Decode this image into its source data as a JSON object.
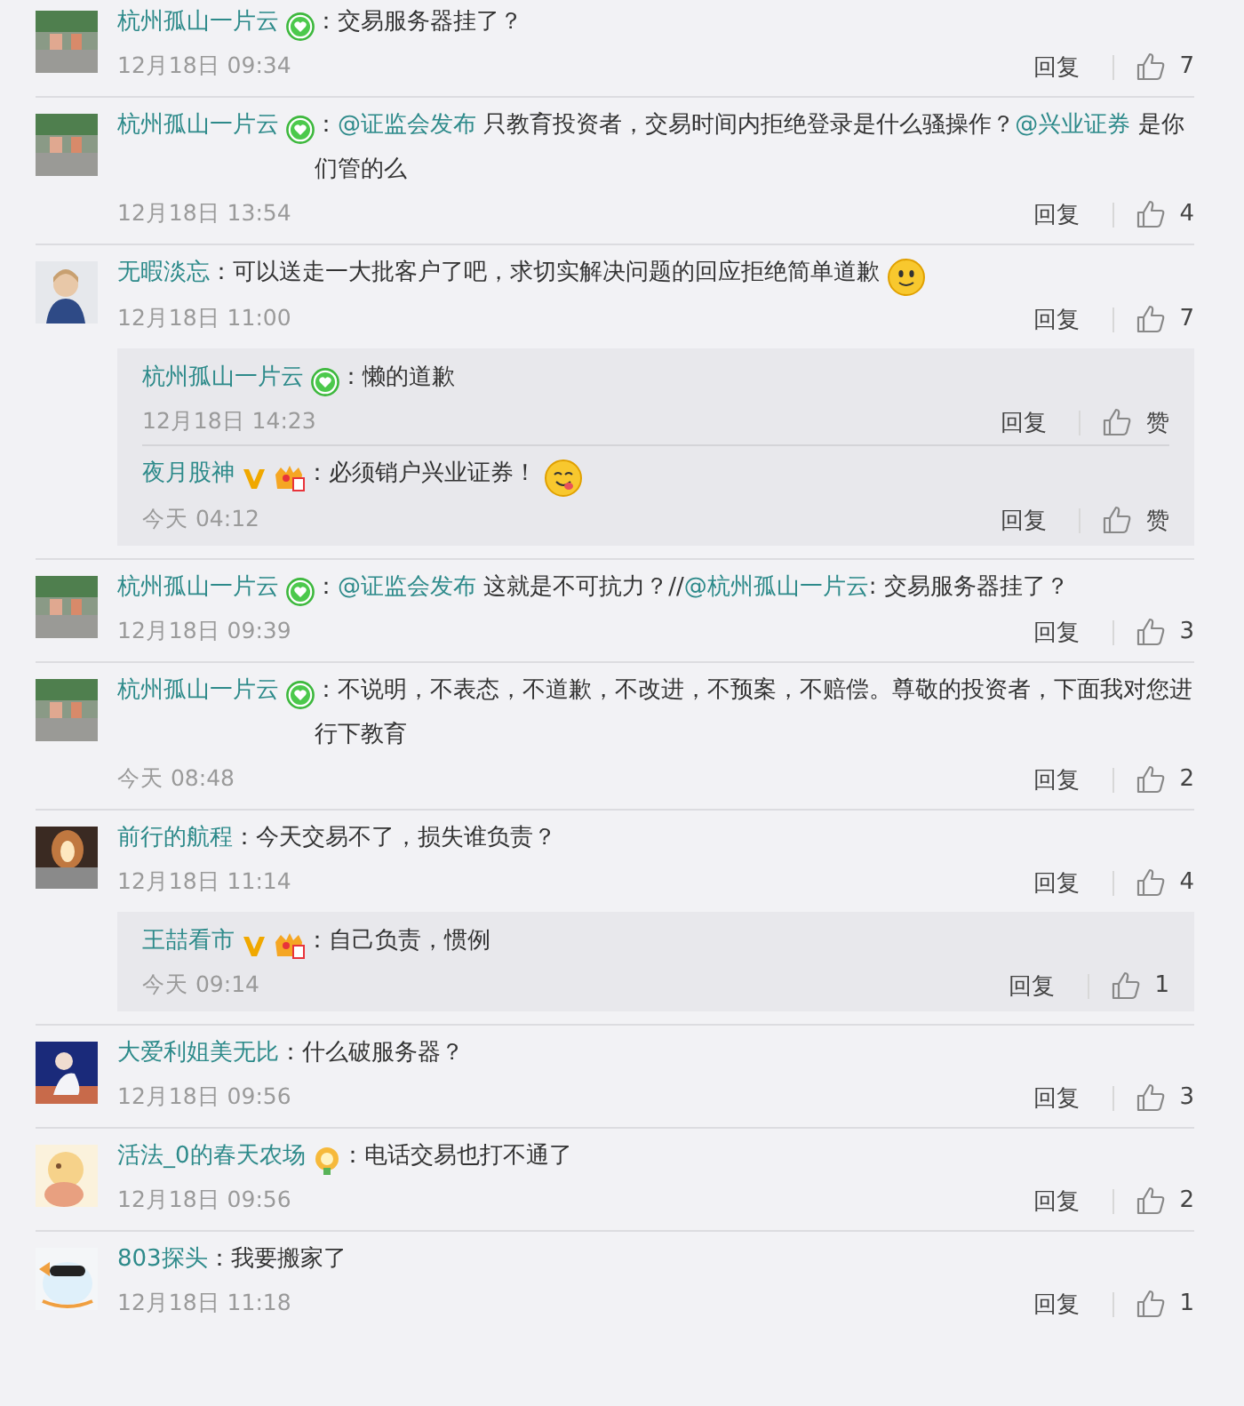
{
  "comments": [
    {
      "author": "杭州孤山一片云",
      "badges": [
        {
          "kind": "member"
        }
      ],
      "segments": [
        {
          "kind": "text",
          "text": "：交易服务器挂了？"
        }
      ],
      "time": "12月18日 09:34",
      "reply_label": "回复",
      "likes": "7"
    },
    {
      "author": "杭州孤山一片云",
      "badges": [
        {
          "kind": "member"
        }
      ],
      "segments": [
        {
          "kind": "text",
          "text": "："
        },
        {
          "kind": "mention",
          "text": "@证监会发布"
        },
        {
          "kind": "text",
          "text": " 只教育投资者，交易时间内拒绝登录是什么骚操作？"
        },
        {
          "kind": "mention",
          "text": "@兴业证券"
        },
        {
          "kind": "text",
          "text": " 是你们管的么"
        }
      ],
      "time": "12月18日 13:54",
      "reply_label": "回复",
      "likes": "4"
    },
    {
      "author": "无暇淡忘",
      "segments": [
        {
          "kind": "text",
          "text": "：可以送走一大批客户了吧，求切实解决问题的回应拒绝简单道歉"
        }
      ],
      "emoji": {
        "kind": "smile"
      },
      "time": "12月18日 11:00",
      "reply_label": "回复",
      "likes": "7",
      "replies": [
        {
          "author": "杭州孤山一片云",
          "badges": [
            {
              "kind": "member"
            }
          ],
          "segments": [
            {
              "kind": "text",
              "text": "：懒的道歉"
            }
          ],
          "time": "12月18日 14:23",
          "reply_label": "回复",
          "likes": "赞"
        },
        {
          "author": "夜月股神",
          "badges": [
            {
              "kind": "verified"
            },
            {
              "kind": "vip"
            }
          ],
          "segments": [
            {
              "kind": "text",
              "text": "：必须销户兴业证券！"
            }
          ],
          "emoji": {
            "kind": "yum"
          },
          "time": "今天 04:12",
          "reply_label": "回复",
          "likes": "赞"
        }
      ]
    },
    {
      "author": "杭州孤山一片云",
      "badges": [
        {
          "kind": "member"
        }
      ],
      "segments": [
        {
          "kind": "text",
          "text": "："
        },
        {
          "kind": "mention",
          "text": "@证监会发布"
        },
        {
          "kind": "text",
          "text": " 这就是不可抗力？//"
        },
        {
          "kind": "mention",
          "text": "@杭州孤山一片云"
        },
        {
          "kind": "text",
          "text": ": 交易服务器挂了？"
        }
      ],
      "time": "12月18日 09:39",
      "reply_label": "回复",
      "likes": "3"
    },
    {
      "author": "杭州孤山一片云",
      "badges": [
        {
          "kind": "member"
        }
      ],
      "segments": [
        {
          "kind": "text",
          "text": "：不说明，不表态，不道歉，不改进，不预案，不赔偿。尊敬的投资者，下面我对您进行下教育"
        }
      ],
      "time": "今天 08:48",
      "reply_label": "回复",
      "likes": "2"
    },
    {
      "author": "前行的航程",
      "segments": [
        {
          "kind": "text",
          "text": "：今天交易不了，损失谁负责？"
        }
      ],
      "time": "12月18日 11:14",
      "reply_label": "回复",
      "likes": "4",
      "replies": [
        {
          "author": "王喆看市",
          "badges": [
            {
              "kind": "verified"
            },
            {
              "kind": "vip"
            }
          ],
          "segments": [
            {
              "kind": "text",
              "text": "：自己负责，惯例"
            }
          ],
          "time": "今天 09:14",
          "reply_label": "回复",
          "likes": "1"
        }
      ]
    },
    {
      "author": "大爱利姐美无比",
      "segments": [
        {
          "kind": "text",
          "text": "：什么破服务器？"
        }
      ],
      "time": "12月18日 09:56",
      "reply_label": "回复",
      "likes": "3"
    },
    {
      "author": "活法_0的春天农场",
      "badges": [
        {
          "kind": "flower"
        }
      ],
      "segments": [
        {
          "kind": "text",
          "text": "：电话交易也打不通了"
        }
      ],
      "time": "12月18日 09:56",
      "reply_label": "回复",
      "likes": "2"
    },
    {
      "author": "803探头",
      "segments": [
        {
          "kind": "text",
          "text": "：我要搬家了"
        }
      ],
      "time": "12月18日 11:18",
      "reply_label": "回复",
      "likes": "1"
    }
  ]
}
